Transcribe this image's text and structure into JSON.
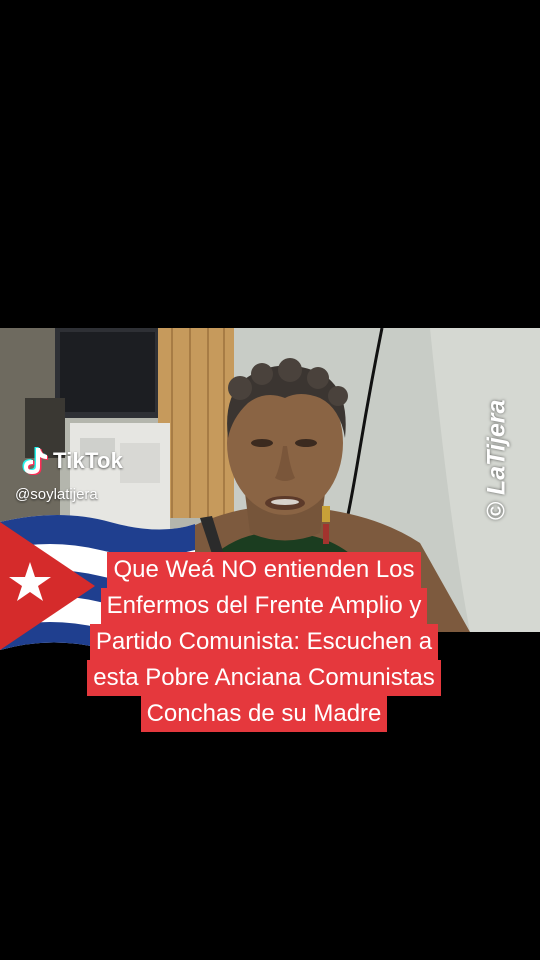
{
  "overlay": {
    "tiktok_wordmark": "TikTok",
    "tiktok_handle": "@soylatijera",
    "watermark": "© LaTijera"
  },
  "caption": {
    "lines": [
      "Que Weá NO entienden Los",
      "Enfermos del Frente Amplio y",
      "Partido Comunista: Escuchen a",
      "esta Pobre Anciana Comunistas",
      "Conchas de su Madre"
    ]
  },
  "colors": {
    "background": "#000000",
    "caption_bg": "#e5383d",
    "caption_text": "#ffffff",
    "flag_blue": "#1f3f8f",
    "flag_red": "#d52b2b"
  }
}
